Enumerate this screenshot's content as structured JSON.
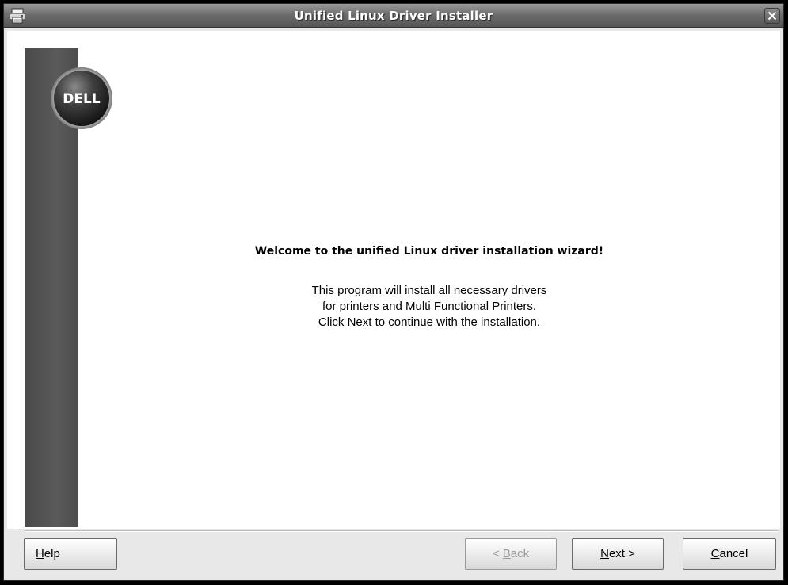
{
  "window": {
    "title": "Unified Linux Driver Installer",
    "app_icon": "printer-icon",
    "close_icon": "close-icon"
  },
  "branding": {
    "logo_text": "DELL",
    "logo_icon": "dell-logo-icon"
  },
  "content": {
    "welcome": "Welcome to the unified Linux driver installation wizard!",
    "description_lines": [
      "This program will install all necessary drivers",
      "for printers and Multi Functional Printers.",
      "Click Next to continue with the installation."
    ]
  },
  "buttons": {
    "help": {
      "mnemonic": "H",
      "rest": "elp"
    },
    "back": {
      "prefix": "< ",
      "mnemonic": "B",
      "rest": "ack",
      "enabled": false
    },
    "next": {
      "mnemonic": "N",
      "rest": "ext >"
    },
    "cancel": {
      "mnemonic": "C",
      "rest": "ancel"
    }
  },
  "colors": {
    "sidebar": "#4f4f4f",
    "titlebar": "#6e6e6e",
    "disabled_text": "#9a9a9a"
  }
}
